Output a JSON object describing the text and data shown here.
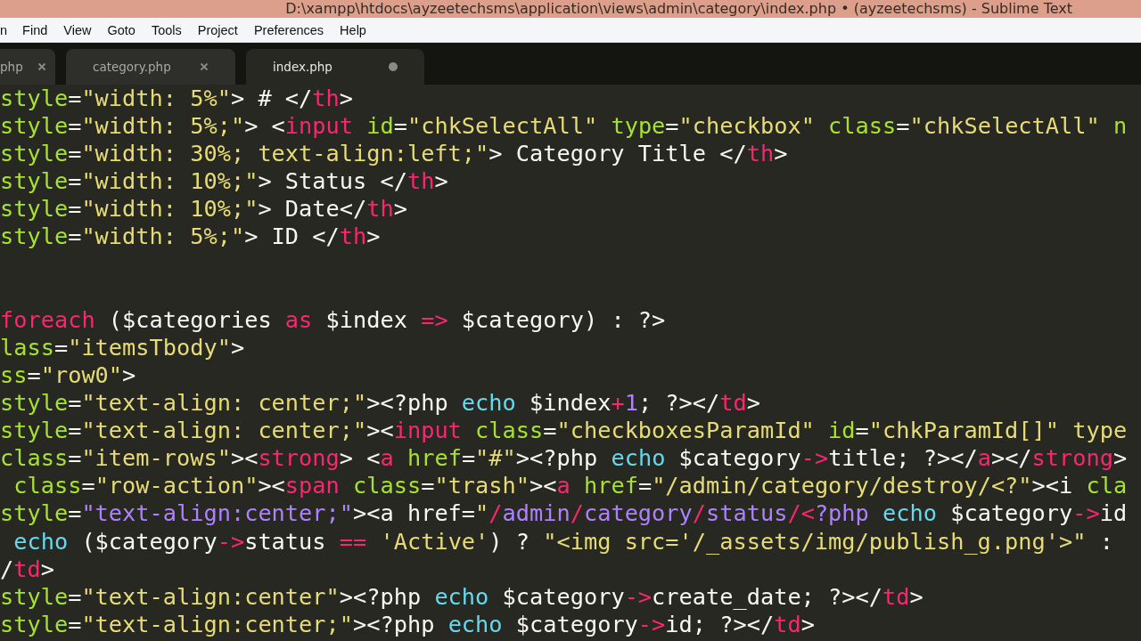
{
  "window": {
    "title": "D:\\xampp\\htdocs\\ayzeetechsms\\application\\views\\admin\\category\\index.php • (ayzeetechsms) - Sublime Text"
  },
  "menu": [
    "n",
    "Find",
    "View",
    "Goto",
    "Tools",
    "Project",
    "Preferences",
    "Help"
  ],
  "tabs": [
    {
      "label": "php",
      "selected": false,
      "modified": false
    },
    {
      "label": "category.php",
      "selected": false,
      "modified": false
    },
    {
      "label": "index.php",
      "selected": true,
      "modified": true
    }
  ],
  "editor": {
    "lines": [
      {
        "kind": "code",
        "tokens": [
          {
            "kind": "attr",
            "text": "style"
          },
          {
            "kind": "plain",
            "text": "="
          },
          {
            "kind": "string",
            "text": "\"width: 5%\""
          },
          {
            "kind": "plain",
            "text": "> # </"
          },
          {
            "kind": "tag",
            "text": "th"
          },
          {
            "kind": "plain",
            "text": ">"
          }
        ]
      },
      {
        "kind": "code",
        "tokens": [
          {
            "kind": "attr",
            "text": "style"
          },
          {
            "kind": "plain",
            "text": "="
          },
          {
            "kind": "string",
            "text": "\"width: 5%;\""
          },
          {
            "kind": "plain",
            "text": "> <"
          },
          {
            "kind": "tag",
            "text": "input"
          },
          {
            "kind": "attr",
            "text": " id"
          },
          {
            "kind": "plain",
            "text": "="
          },
          {
            "kind": "string",
            "text": "\"chkSelectAll\""
          },
          {
            "kind": "attr",
            "text": " type"
          },
          {
            "kind": "plain",
            "text": "="
          },
          {
            "kind": "string",
            "text": "\"checkbox\""
          },
          {
            "kind": "attr",
            "text": " class"
          },
          {
            "kind": "plain",
            "text": "="
          },
          {
            "kind": "string",
            "text": "\"chkSelectAll\""
          },
          {
            "kind": "attr",
            "text": " n"
          }
        ]
      },
      {
        "kind": "code",
        "tokens": [
          {
            "kind": "attr",
            "text": "style"
          },
          {
            "kind": "plain",
            "text": "="
          },
          {
            "kind": "string",
            "text": "\"width: 30%; text-align:left;\""
          },
          {
            "kind": "plain",
            "text": "> Category Title </"
          },
          {
            "kind": "tag",
            "text": "th"
          },
          {
            "kind": "plain",
            "text": ">"
          }
        ]
      },
      {
        "kind": "code",
        "tokens": [
          {
            "kind": "attr",
            "text": "style"
          },
          {
            "kind": "plain",
            "text": "="
          },
          {
            "kind": "string",
            "text": "\"width: 10%;\""
          },
          {
            "kind": "plain",
            "text": "> Status </"
          },
          {
            "kind": "tag",
            "text": "th"
          },
          {
            "kind": "plain",
            "text": ">"
          }
        ]
      },
      {
        "kind": "code",
        "tokens": [
          {
            "kind": "attr",
            "text": "style"
          },
          {
            "kind": "plain",
            "text": "="
          },
          {
            "kind": "string",
            "text": "\"width: 10%;\""
          },
          {
            "kind": "plain",
            "text": "> Date</"
          },
          {
            "kind": "tag",
            "text": "th"
          },
          {
            "kind": "plain",
            "text": ">"
          }
        ]
      },
      {
        "kind": "code",
        "tokens": [
          {
            "kind": "attr",
            "text": "style"
          },
          {
            "kind": "plain",
            "text": "="
          },
          {
            "kind": "string",
            "text": "\"width: 5%;\""
          },
          {
            "kind": "plain",
            "text": "> ID </"
          },
          {
            "kind": "tag",
            "text": "th"
          },
          {
            "kind": "plain",
            "text": ">"
          }
        ]
      },
      {
        "kind": "blank"
      },
      {
        "kind": "blank"
      },
      {
        "kind": "code",
        "tokens": [
          {
            "kind": "tag",
            "text": "foreach"
          },
          {
            "kind": "plain",
            "text": " ($categories "
          },
          {
            "kind": "tag",
            "text": "as"
          },
          {
            "kind": "plain",
            "text": " $index "
          },
          {
            "kind": "tag",
            "text": "=>"
          },
          {
            "kind": "plain",
            "text": " $category) : ?>"
          }
        ]
      },
      {
        "kind": "code",
        "tokens": [
          {
            "kind": "attr",
            "text": "lass"
          },
          {
            "kind": "plain",
            "text": "="
          },
          {
            "kind": "string",
            "text": "\"itemsTbody\""
          },
          {
            "kind": "plain",
            "text": ">"
          }
        ]
      },
      {
        "kind": "code",
        "tokens": [
          {
            "kind": "attr",
            "text": "ss"
          },
          {
            "kind": "plain",
            "text": "="
          },
          {
            "kind": "string",
            "text": "\"row0\""
          },
          {
            "kind": "plain",
            "text": ">"
          }
        ]
      },
      {
        "kind": "code",
        "tokens": [
          {
            "kind": "attr",
            "text": "style"
          },
          {
            "kind": "plain",
            "text": "="
          },
          {
            "kind": "string",
            "text": "\"text-align: center;\""
          },
          {
            "kind": "plain",
            "text": "><?php "
          },
          {
            "kind": "func",
            "text": "echo"
          },
          {
            "kind": "plain",
            "text": " $index"
          },
          {
            "kind": "tag",
            "text": "+"
          },
          {
            "kind": "number",
            "text": "1"
          },
          {
            "kind": "plain",
            "text": "; ?></"
          },
          {
            "kind": "tag",
            "text": "td"
          },
          {
            "kind": "plain",
            "text": ">"
          }
        ]
      },
      {
        "kind": "code",
        "tokens": [
          {
            "kind": "attr",
            "text": "style"
          },
          {
            "kind": "plain",
            "text": "="
          },
          {
            "kind": "string",
            "text": "\"text-align: center;\""
          },
          {
            "kind": "plain",
            "text": "><"
          },
          {
            "kind": "tag",
            "text": "input"
          },
          {
            "kind": "attr",
            "text": " class"
          },
          {
            "kind": "plain",
            "text": "="
          },
          {
            "kind": "string",
            "text": "\"checkboxesParamId\""
          },
          {
            "kind": "attr",
            "text": " id"
          },
          {
            "kind": "plain",
            "text": "="
          },
          {
            "kind": "string",
            "text": "\"chkParamId[]\" type"
          }
        ]
      },
      {
        "kind": "code",
        "tokens": [
          {
            "kind": "attr",
            "text": "class"
          },
          {
            "kind": "plain",
            "text": "="
          },
          {
            "kind": "string",
            "text": "\"item-rows\""
          },
          {
            "kind": "plain",
            "text": "><"
          },
          {
            "kind": "tag",
            "text": "strong"
          },
          {
            "kind": "plain",
            "text": "> <"
          },
          {
            "kind": "tag",
            "text": "a"
          },
          {
            "kind": "attr",
            "text": " href"
          },
          {
            "kind": "plain",
            "text": "="
          },
          {
            "kind": "string",
            "text": "\"#\""
          },
          {
            "kind": "plain",
            "text": "><?php "
          },
          {
            "kind": "func",
            "text": "echo"
          },
          {
            "kind": "plain",
            "text": " $category"
          },
          {
            "kind": "tag",
            "text": "->"
          },
          {
            "kind": "plain",
            "text": "title; ?></"
          },
          {
            "kind": "tag",
            "text": "a"
          },
          {
            "kind": "plain",
            "text": "></"
          },
          {
            "kind": "tag",
            "text": "strong"
          },
          {
            "kind": "plain",
            "text": ">"
          }
        ]
      },
      {
        "kind": "code",
        "tokens": [
          {
            "kind": "attr",
            "text": " class"
          },
          {
            "kind": "plain",
            "text": "="
          },
          {
            "kind": "string",
            "text": "\"row-action\""
          },
          {
            "kind": "plain",
            "text": "><"
          },
          {
            "kind": "tag",
            "text": "span"
          },
          {
            "kind": "attr",
            "text": " class"
          },
          {
            "kind": "plain",
            "text": "="
          },
          {
            "kind": "string",
            "text": "\"trash\""
          },
          {
            "kind": "plain",
            "text": "><"
          },
          {
            "kind": "tag",
            "text": "a"
          },
          {
            "kind": "attr",
            "text": " href"
          },
          {
            "kind": "plain",
            "text": "="
          },
          {
            "kind": "string",
            "text": "\"/admin/category/destroy/<?\""
          },
          {
            "kind": "plain",
            "text": "><i"
          },
          {
            "kind": "attr",
            "text": " cla"
          }
        ]
      },
      {
        "kind": "code",
        "tokens": [
          {
            "kind": "attr",
            "text": "style"
          },
          {
            "kind": "plain",
            "text": "="
          },
          {
            "kind": "css",
            "text": "\"text-align:center;\""
          },
          {
            "kind": "plain",
            "text": "><a href="
          },
          {
            "kind": "string",
            "text": "\""
          },
          {
            "kind": "tag",
            "text": "/"
          },
          {
            "kind": "css",
            "text": "admin"
          },
          {
            "kind": "tag",
            "text": "/"
          },
          {
            "kind": "css",
            "text": "category"
          },
          {
            "kind": "tag",
            "text": "/"
          },
          {
            "kind": "css",
            "text": "status"
          },
          {
            "kind": "tag",
            "text": "/<"
          },
          {
            "kind": "css",
            "text": "?php"
          },
          {
            "kind": "func",
            "text": " echo"
          },
          {
            "kind": "plain",
            "text": " $category"
          },
          {
            "kind": "tag",
            "text": "->"
          },
          {
            "kind": "plain",
            "text": "id"
          }
        ]
      },
      {
        "kind": "code",
        "tokens": [
          {
            "kind": "func",
            "text": " echo"
          },
          {
            "kind": "plain",
            "text": " ($category"
          },
          {
            "kind": "tag",
            "text": "->"
          },
          {
            "kind": "plain",
            "text": "status "
          },
          {
            "kind": "tag",
            "text": "=="
          },
          {
            "kind": "string",
            "text": " 'Active'"
          },
          {
            "kind": "plain",
            "text": ") ? "
          },
          {
            "kind": "string",
            "text": "\"<img src='/_assets/img/publish_g.png'>\""
          },
          {
            "kind": "plain",
            "text": " :"
          }
        ]
      },
      {
        "kind": "code",
        "tokens": [
          {
            "kind": "plain",
            "text": "/"
          },
          {
            "kind": "tag",
            "text": "td"
          },
          {
            "kind": "plain",
            "text": ">"
          }
        ]
      },
      {
        "kind": "code",
        "tokens": [
          {
            "kind": "attr",
            "text": "style"
          },
          {
            "kind": "plain",
            "text": "="
          },
          {
            "kind": "string",
            "text": "\"text-align:center\""
          },
          {
            "kind": "plain",
            "text": "><?php "
          },
          {
            "kind": "func",
            "text": "echo"
          },
          {
            "kind": "plain",
            "text": " $category"
          },
          {
            "kind": "tag",
            "text": "->"
          },
          {
            "kind": "plain",
            "text": "create_date; ?></"
          },
          {
            "kind": "tag",
            "text": "td"
          },
          {
            "kind": "plain",
            "text": ">"
          }
        ]
      },
      {
        "kind": "code",
        "tokens": [
          {
            "kind": "attr",
            "text": "style"
          },
          {
            "kind": "plain",
            "text": "="
          },
          {
            "kind": "string",
            "text": "\"text-align:center;\""
          },
          {
            "kind": "plain",
            "text": "><?php "
          },
          {
            "kind": "func",
            "text": "echo"
          },
          {
            "kind": "plain",
            "text": " $category"
          },
          {
            "kind": "tag",
            "text": "->"
          },
          {
            "kind": "plain",
            "text": "id; ?></"
          },
          {
            "kind": "tag",
            "text": "td"
          },
          {
            "kind": "plain",
            "text": ">"
          }
        ]
      }
    ]
  }
}
